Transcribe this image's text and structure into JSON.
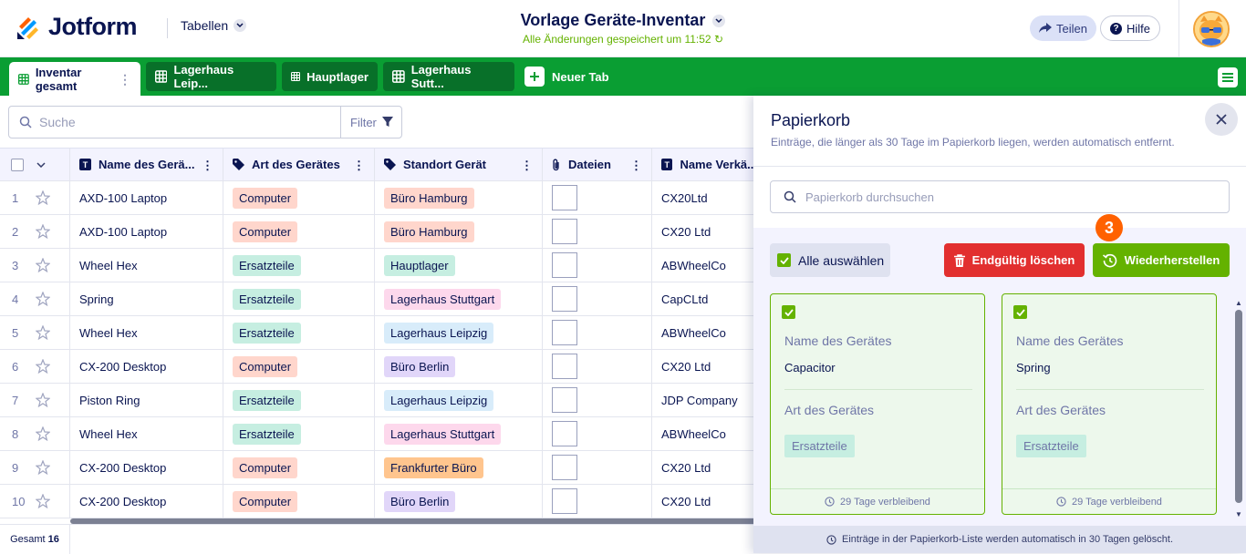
{
  "header": {
    "logo": "Jotform",
    "tables_label": "Tabellen",
    "title": "Vorlage Geräte-Inventar",
    "saved_status": "Alle Änderungen gespeichert um 11:52",
    "share_label": "Teilen",
    "help_label": "Hilfe"
  },
  "tabs": [
    {
      "label": "Inventar gesamt"
    },
    {
      "label": "Lagerhaus Leip..."
    },
    {
      "label": "Hauptlager"
    },
    {
      "label": "Lagerhaus Sutt..."
    }
  ],
  "new_tab_label": "Neuer Tab",
  "toolbar": {
    "search_placeholder": "Suche",
    "filter_label": "Filter"
  },
  "columns": [
    "Name des Gerä...",
    "Art des Gerätes",
    "Standort Gerät",
    "Dateien",
    "Name Verkä..."
  ],
  "rows": [
    {
      "n": "1",
      "name": "AXD-100 Laptop",
      "art": "Computer",
      "standort": "Büro Hamburg",
      "vendor": "CX20Ltd"
    },
    {
      "n": "2",
      "name": "AXD-100 Laptop",
      "art": "Computer",
      "standort": "Büro Hamburg",
      "vendor": "CX20 Ltd"
    },
    {
      "n": "3",
      "name": "Wheel Hex",
      "art": "Ersatzteile",
      "standort": "Hauptlager",
      "vendor": "ABWheelCo"
    },
    {
      "n": "4",
      "name": "Spring",
      "art": "Ersatzteile",
      "standort": "Lagerhaus Stuttgart",
      "vendor": "CapCLtd"
    },
    {
      "n": "5",
      "name": "Wheel Hex",
      "art": "Ersatzteile",
      "standort": "Lagerhaus Leipzig",
      "vendor": "ABWheelCo"
    },
    {
      "n": "6",
      "name": "CX-200 Desktop",
      "art": "Computer",
      "standort": "Büro Berlin",
      "vendor": "CX20 Ltd"
    },
    {
      "n": "7",
      "name": "Piston Ring",
      "art": "Ersatzteile",
      "standort": "Lagerhaus Leipzig",
      "vendor": "JDP Company"
    },
    {
      "n": "8",
      "name": "Wheel Hex",
      "art": "Ersatzteile",
      "standort": "Lagerhaus Stuttgart",
      "vendor": "ABWheelCo"
    },
    {
      "n": "9",
      "name": "CX-200 Desktop",
      "art": "Computer",
      "standort": "Frankfurter Büro",
      "vendor": "CX20 Ltd"
    },
    {
      "n": "10",
      "name": "CX-200 Desktop",
      "art": "Computer",
      "standort": "Büro Berlin",
      "vendor": "CX20 Ltd"
    }
  ],
  "tag_colors": {
    "Computer": "#ffd6cc",
    "Ersatzteile": "#c6eee1",
    "Büro Hamburg": "#ffd6cc",
    "Hauptlager": "#c6eee1",
    "Lagerhaus Stuttgart": "#fdd8ec",
    "Lagerhaus Leipzig": "#d8ecfa",
    "Büro Berlin": "#e1d6f9",
    "Frankfurter Büro": "#ffc58e"
  },
  "footer": {
    "total_label": "Gesamt",
    "total": "16"
  },
  "panel": {
    "title": "Papierkorb",
    "description": "Einträge, die länger als 30 Tage im Papierkorb liegen, werden automatisch entfernt.",
    "search_placeholder": "Papierkorb durchsuchen",
    "select_all": "Alle auswählen",
    "delete_label": "Endgültig löschen",
    "restore_label": "Wiederherstellen",
    "step_badge": "3",
    "footer_note": "Einträge in der Papierkorb-Liste werden automatisch in 30 Tagen gelöscht."
  },
  "cards": [
    {
      "field1": "Name des Gerätes",
      "value1": "Capacitor",
      "field2": "Art des Gerätes",
      "tag": "Ersatzteile",
      "remaining": "29 Tage verbleibend"
    },
    {
      "field1": "Name des Gerätes",
      "value1": "Spring",
      "field2": "Art des Gerätes",
      "tag": "Ersatzteile",
      "remaining": "29 Tage verbleibend"
    }
  ],
  "colors": {
    "brand_green": "#0a9e33",
    "restore_green": "#64b200",
    "delete_red": "#e22f2f",
    "badge_orange": "#ff6100",
    "navy": "#0a1551"
  }
}
